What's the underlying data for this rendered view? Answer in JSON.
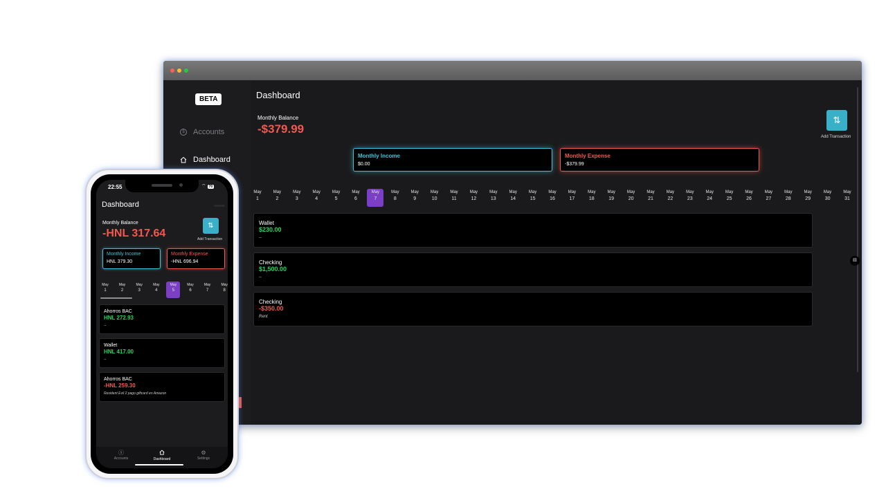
{
  "desktop": {
    "sidebar": {
      "badge": "BETA",
      "items": [
        {
          "label": "Accounts",
          "icon": "dollar-circle-icon",
          "active": false
        },
        {
          "label": "Dashboard",
          "icon": "home-icon",
          "active": true
        }
      ]
    },
    "title": "Dashboard",
    "balance_label": "Monthly Balance",
    "balance_value": "-$379.99",
    "add_button_label": "Add Transaction",
    "income": {
      "label": "Monthly Income",
      "value": "$0.00"
    },
    "expense": {
      "label": "Monthly Expense",
      "value": "-$379.99"
    },
    "month": "May",
    "days": [
      "1",
      "2",
      "3",
      "4",
      "5",
      "6",
      "7",
      "8",
      "9",
      "10",
      "11",
      "12",
      "13",
      "14",
      "15",
      "16",
      "17",
      "18",
      "19",
      "20",
      "21",
      "22",
      "23",
      "24",
      "25",
      "26",
      "27",
      "28",
      "29",
      "30",
      "31"
    ],
    "selected_day": "7",
    "transactions": [
      {
        "account": "Wallet",
        "amount": "$230.00",
        "note": "--",
        "type": "income"
      },
      {
        "account": "Checking",
        "amount": "$1,500.00",
        "note": "--",
        "type": "income"
      },
      {
        "account": "Checking",
        "amount": "-$350.00",
        "note": "Rent",
        "type": "expense"
      }
    ]
  },
  "phone": {
    "time": "22:55",
    "battery": "70",
    "title": "Dashboard",
    "balance_label": "Monthly Balance",
    "balance_value": "-HNL 317.64",
    "add_button_label": "Add Transaction",
    "income": {
      "label": "Monthly Income",
      "value": "HNL 379.30"
    },
    "expense": {
      "label": "Monthly Expense",
      "value": "-HNL 696.94"
    },
    "month": "May",
    "days": [
      "1",
      "2",
      "3",
      "4",
      "5",
      "6",
      "7",
      "8"
    ],
    "selected_day": "5",
    "transactions": [
      {
        "account": "Ahorros BAC",
        "amount": "HNL 272.93",
        "note": "--",
        "type": "income"
      },
      {
        "account": "Wallet",
        "amount": "HNL 417.00",
        "note": "--",
        "type": "income"
      },
      {
        "account": "Ahorros BAC",
        "amount": "-HNL 259.30",
        "note": "Resident Evil 2 pago giftcard en Amazon",
        "type": "expense"
      }
    ],
    "tabs": [
      {
        "label": "Accounts",
        "icon": "dollar-circle-icon",
        "active": false
      },
      {
        "label": "Dashboard",
        "icon": "home-icon",
        "active": true
      },
      {
        "label": "Settings",
        "icon": "gear-icon",
        "active": false
      }
    ]
  },
  "colors": {
    "income": "#3fc3d8",
    "expense": "#f0594e",
    "positive_amount": "#1fd55f",
    "selected_day": "#7b3fc6",
    "add_button": "#3ab0c8"
  }
}
